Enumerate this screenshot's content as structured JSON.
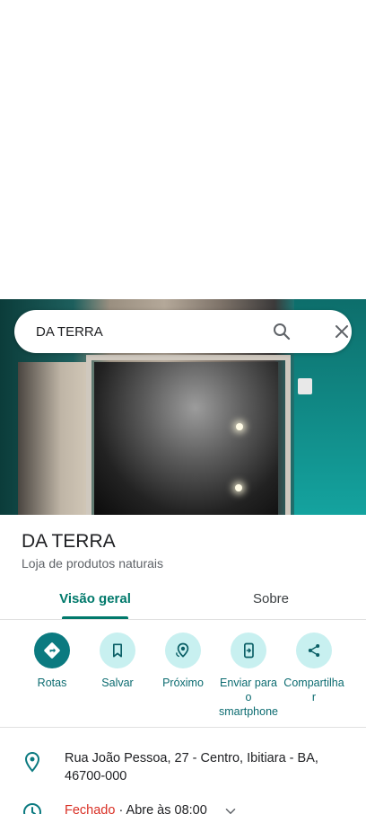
{
  "search": {
    "query": "DA TERRA"
  },
  "place": {
    "name": "DA TERRA",
    "category": "Loja de produtos naturais"
  },
  "tabs": [
    {
      "label": "Visão geral",
      "active": true
    },
    {
      "label": "Sobre",
      "active": false
    }
  ],
  "actions": [
    {
      "label": "Rotas",
      "icon": "directions-icon"
    },
    {
      "label": "Salvar",
      "icon": "bookmark-icon"
    },
    {
      "label": "Próximo",
      "icon": "nearby-icon"
    },
    {
      "label_line1": "Enviar para",
      "label_line2": "o",
      "label_line3": "smartphone",
      "icon": "send-to-phone-icon"
    },
    {
      "label_line1": "Compartilha",
      "label_line2": "r",
      "icon": "share-icon"
    }
  ],
  "address": {
    "line1": "Rua João Pessoa, 27 - Centro, Ibitiara - BA,",
    "line2": "46700-000"
  },
  "hours": {
    "status": "Fechado",
    "next": " · Abre às 08:00"
  },
  "colors": {
    "accent": "#00796b",
    "primary_button": "#0b7a80",
    "closed": "#d93025"
  }
}
